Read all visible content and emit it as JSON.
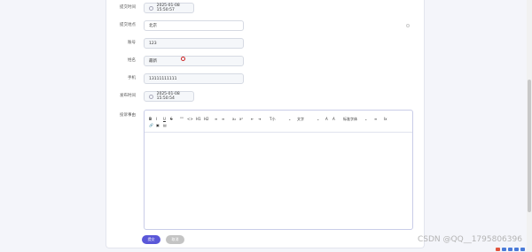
{
  "form": {
    "fields": [
      {
        "label": "提交时间",
        "value": "2025-01-08 15:50:57",
        "type": "date"
      },
      {
        "label": "提交地点",
        "value": "北京",
        "type": "text"
      },
      {
        "label": "账号",
        "value": "123",
        "type": "text"
      },
      {
        "label": "姓名",
        "value": "最新",
        "type": "text"
      },
      {
        "label": "手机",
        "value": "13111111111",
        "type": "text"
      },
      {
        "label": "发布时间",
        "value": "2025-01-08 15:50:54",
        "type": "date"
      }
    ],
    "editor_label": "投诉事由"
  },
  "toolbar": {
    "row1": [
      "B",
      "I",
      "U",
      "S",
      "\"\"",
      "<>",
      "H1",
      "H2",
      "≡",
      "≡",
      "x₂",
      "x²",
      "⇤",
      "⇥",
      "T小",
      "⌄",
      "文字",
      "⌄",
      "A",
      "A",
      "标准字体",
      "⌄",
      "≡",
      "Ix"
    ],
    "row2": [
      "🔗",
      "▣",
      "▤"
    ]
  },
  "buttons": {
    "submit": "提交",
    "cancel": "取消"
  },
  "watermark": "CSDN @QQ__1795806396",
  "colors": {
    "submit": "#5a57d8",
    "cancel": "#c4c4c4"
  }
}
